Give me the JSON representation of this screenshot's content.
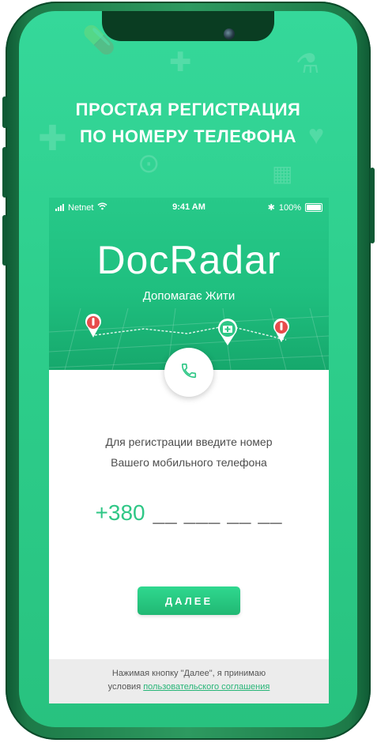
{
  "promo": {
    "headline_line1": "ПРОСТАЯ РЕГИСТРАЦИЯ",
    "headline_line2": "ПО НОМЕРУ ТЕЛЕФОНА"
  },
  "status_bar": {
    "carrier": "Netnet",
    "time": "9:41 AM",
    "battery": "100%"
  },
  "brand": {
    "logo": "DocRadar",
    "tagline": "Допомагає Жити"
  },
  "registration": {
    "instruction_line1": "Для регистрации введите номер",
    "instruction_line2": "Вашего мобильного телефона",
    "phone_prefix": "+380",
    "phone_mask": "__ ___ __ __",
    "next_label": "ДАЛЕЕ"
  },
  "footer": {
    "text_line1": "Нажимая кнопку \"Далее\", я принимаю",
    "text_prefix": "условия ",
    "terms_link": "пользовательского соглашения"
  },
  "colors": {
    "brand_green": "#2fc786",
    "phone_frame": "#1d7a48",
    "footer_bg": "#ececec"
  }
}
